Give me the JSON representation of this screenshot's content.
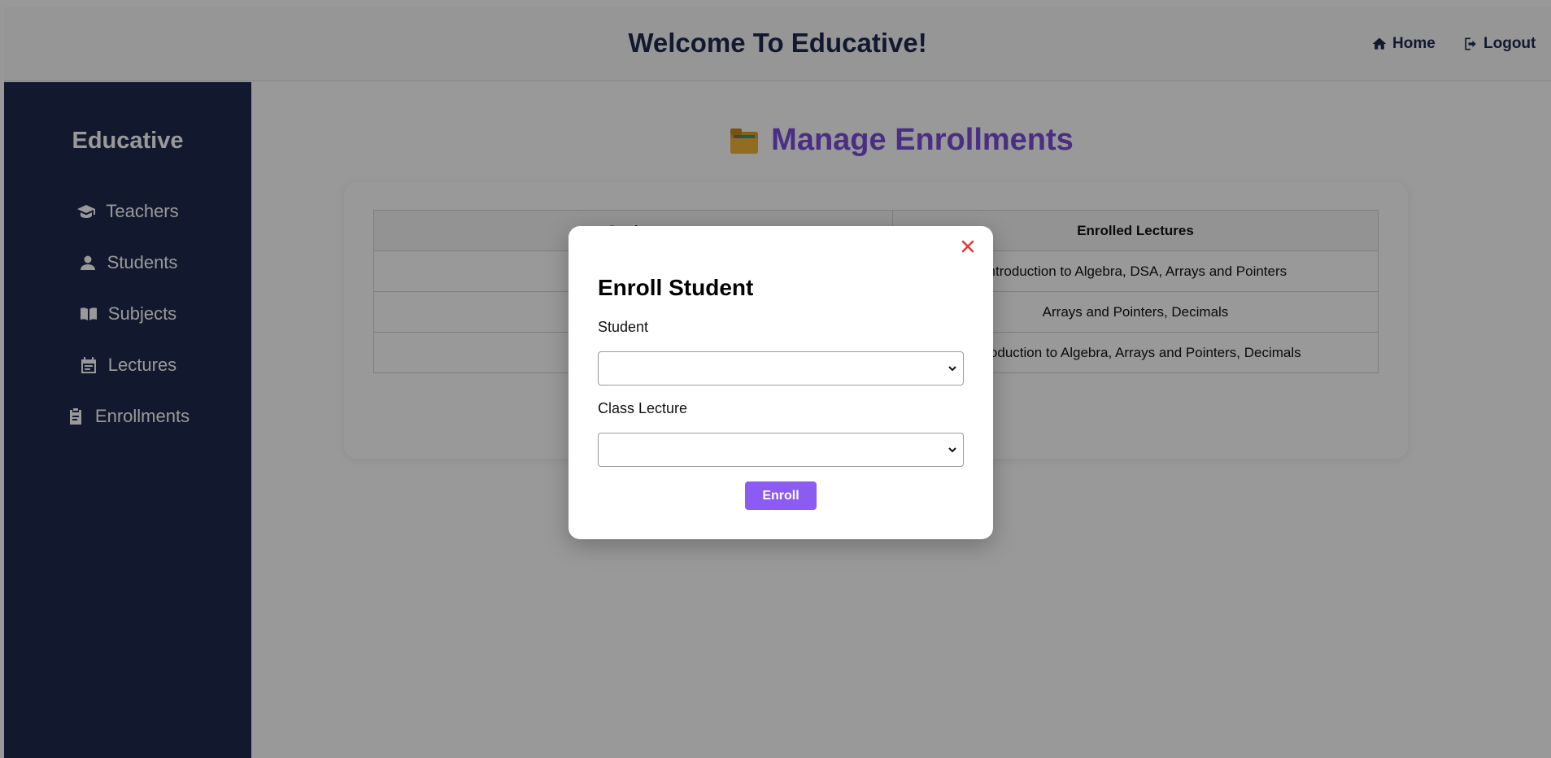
{
  "header": {
    "title": "Welcome To Educative!",
    "home_label": "Home",
    "logout_label": "Logout"
  },
  "sidebar": {
    "brand": "Educative",
    "items": [
      {
        "label": "Teachers",
        "icon": "graduation-cap-icon"
      },
      {
        "label": "Students",
        "icon": "user-icon"
      },
      {
        "label": "Subjects",
        "icon": "book-icon"
      },
      {
        "label": "Lectures",
        "icon": "calendar-icon"
      },
      {
        "label": "Enrollments",
        "icon": "clipboard-icon"
      }
    ]
  },
  "main": {
    "title": "Manage Enrollments",
    "title_icon": "folder-emoji",
    "table": {
      "headers": [
        "Student",
        "Enrolled Lectures"
      ],
      "rows": [
        {
          "student": "",
          "lectures": "Introduction to Algebra, DSA, Arrays and Pointers"
        },
        {
          "student": "",
          "lectures": "Arrays and Pointers, Decimals"
        },
        {
          "student": "",
          "lectures": "Introduction to Algebra, Arrays and Pointers, Decimals"
        }
      ]
    }
  },
  "modal": {
    "title": "Enroll Student",
    "student_label": "Student",
    "student_value": "",
    "lecture_label": "Class Lecture",
    "lecture_value": "",
    "submit_label": "Enroll",
    "close_icon": "close-icon"
  },
  "colors": {
    "navy": "#1e2a4f",
    "accent_purple": "#7c4ddb",
    "button_purple": "#8c5bf2",
    "close_red": "#e53935"
  }
}
